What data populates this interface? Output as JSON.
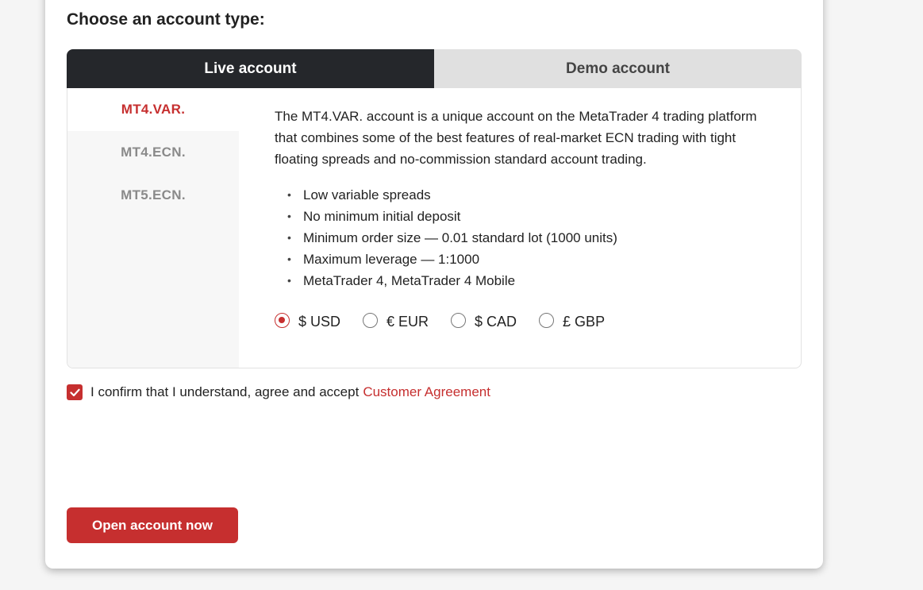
{
  "heading": "Choose an account type:",
  "tabs": [
    {
      "label": "Live account",
      "active": true
    },
    {
      "label": "Demo account",
      "active": false
    }
  ],
  "account_types": [
    {
      "label": "MT4.VAR.",
      "active": true
    },
    {
      "label": "MT4.ECN.",
      "active": false
    },
    {
      "label": "MT5.ECN.",
      "active": false
    }
  ],
  "description": "The MT4.VAR. account is a unique account on the MetaTrader 4 trading platform that combines some of the best features of real-market ECN trading with tight floating spreads and no-commission standard account trading.",
  "features": [
    "Low variable spreads",
    "No minimum initial deposit",
    "Minimum order size — 0.01 standard lot (1000 units)",
    "Maximum leverage — 1:1000",
    "MetaTrader 4, MetaTrader 4 Mobile"
  ],
  "bullet": "•",
  "currencies": [
    {
      "label": "$ USD",
      "selected": true
    },
    {
      "label": "€ EUR",
      "selected": false
    },
    {
      "label": "$ CAD",
      "selected": false
    },
    {
      "label": "£ GBP",
      "selected": false
    }
  ],
  "agreement": {
    "text": "I confirm that I understand, agree and accept",
    "link": "Customer Agreement",
    "checked": true
  },
  "open_button": "Open account now",
  "colors": {
    "accent": "#c62f2f",
    "tab_active_bg": "#25272b",
    "tab_inactive_bg": "#e0e0e0"
  }
}
